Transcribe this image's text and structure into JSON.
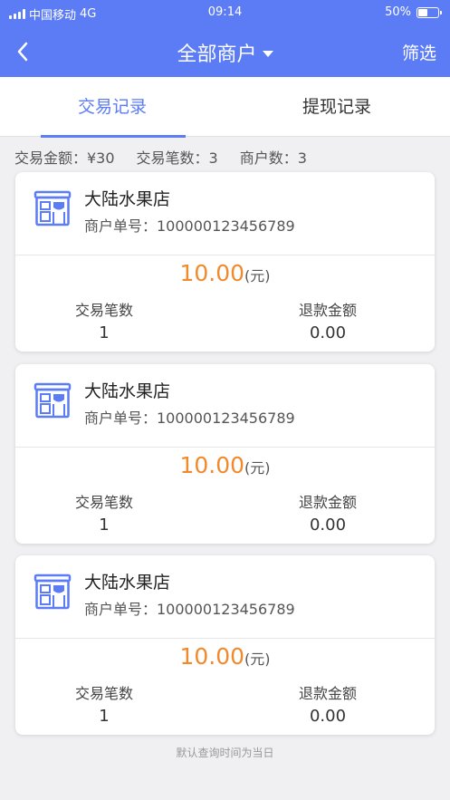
{
  "status": {
    "carrier": "中国移动",
    "network": "4G",
    "time": "09:14",
    "battery": "50%",
    "battery_level": 0.5
  },
  "nav": {
    "back_icon": "chevron-left-icon",
    "title": "全部商户",
    "filter": "筛选"
  },
  "tabs": [
    {
      "label": "交易记录",
      "active": true
    },
    {
      "label": "提现记录",
      "active": false
    }
  ],
  "summary": {
    "amount": "交易金额：¥30",
    "count": "交易笔数：3",
    "merchants": "商户数：3"
  },
  "cards": [
    {
      "name": "大陆水果店",
      "order_no": "商户单号：100000123456789",
      "amount": "10.00",
      "unit": "(元)",
      "count_label": "交易笔数",
      "count": "1",
      "refund_label": "退款金额",
      "refund": "0.00"
    },
    {
      "name": "大陆水果店",
      "order_no": "商户单号：100000123456789",
      "amount": "10.00",
      "unit": "(元)",
      "count_label": "交易笔数",
      "count": "1",
      "refund_label": "退款金额",
      "refund": "0.00"
    },
    {
      "name": "大陆水果店",
      "order_no": "商户单号：100000123456789",
      "amount": "10.00",
      "unit": "(元)",
      "count_label": "交易笔数",
      "count": "1",
      "refund_label": "退款金额",
      "refund": "0.00"
    }
  ],
  "footer_note": "默认查询时间为当日",
  "colors": {
    "primary": "#5b7cf5",
    "amount": "#f08a2c"
  }
}
